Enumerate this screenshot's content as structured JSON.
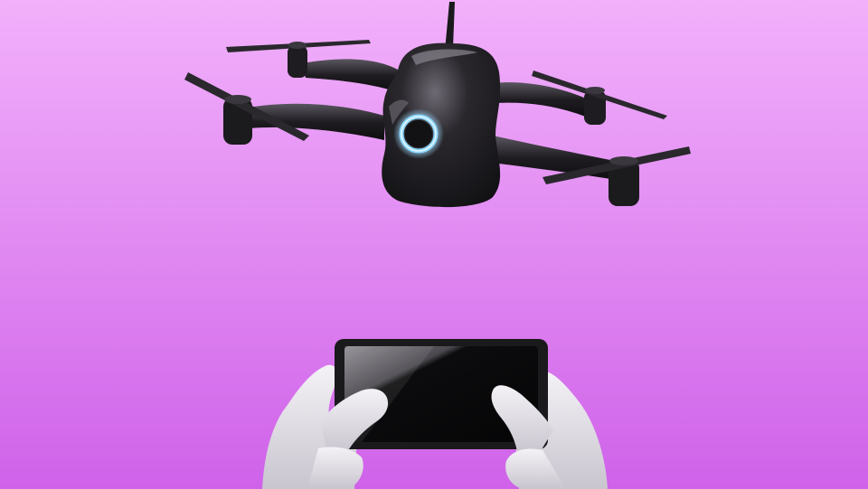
{
  "scene": {
    "background_top": "#f2b1fb",
    "background_bottom": "#cf62e9",
    "drone_body": "#1e1c20",
    "drone_highlight": "#8a8690",
    "status_ring": "#8ed8ff",
    "tablet_frame": "#1a191c",
    "tablet_screen": "#050506",
    "hand_color": "#e4e1e8"
  },
  "icons": {
    "drone": "drone-icon",
    "status_light": "status-ring-icon",
    "controller": "tablet-icon"
  }
}
